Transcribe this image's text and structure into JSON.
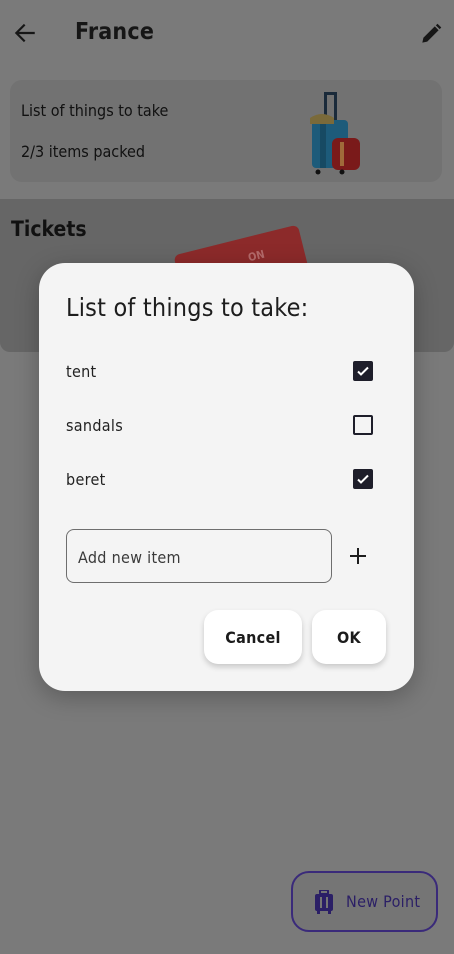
{
  "appbar": {
    "title": "France",
    "back_icon": "arrow-left-icon",
    "edit_icon": "pencil-icon"
  },
  "packing_card": {
    "title": "List of things to take",
    "progress": "2/3 items packed"
  },
  "tickets": {
    "title": "Tickets",
    "ticket_text": "ON"
  },
  "fab": {
    "label": "New Point",
    "icon": "luggage-icon"
  },
  "dialog": {
    "title": "List of things to take:",
    "items": [
      {
        "label": "tent",
        "checked": true
      },
      {
        "label": "sandals",
        "checked": false
      },
      {
        "label": "beret",
        "checked": true
      }
    ],
    "new_item_placeholder": "Add new item",
    "new_item_value": "",
    "add_icon": "plus-icon",
    "cancel_label": "Cancel",
    "ok_label": "OK"
  },
  "colors": {
    "scrim": "#7a7a7a",
    "dialog_bg": "#f4f4f4",
    "checkbox": "#1e1e2a",
    "fab_accent": "#2b1f66"
  }
}
